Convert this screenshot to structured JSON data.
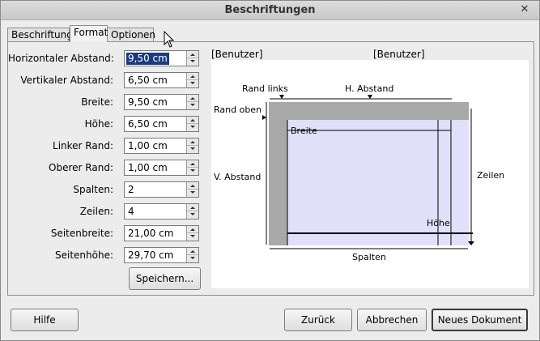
{
  "window": {
    "title": "Beschriftungen"
  },
  "tabs": [
    {
      "label": "Beschriftung",
      "active": false
    },
    {
      "label": "Format",
      "active": true
    },
    {
      "label": "Optionen",
      "active": false
    }
  ],
  "fields": [
    {
      "label": "Horizontaler Abstand:",
      "value": "9,50 cm",
      "selected": true
    },
    {
      "label": "Vertikaler Abstand:",
      "value": "6,50 cm"
    },
    {
      "label": "Breite:",
      "value": "9,50 cm"
    },
    {
      "label": "Höhe:",
      "value": "6,50 cm"
    },
    {
      "label": "Linker Rand:",
      "value": "1,00 cm"
    },
    {
      "label": "Oberer Rand:",
      "value": "1,00 cm"
    },
    {
      "label": "Spalten:",
      "value": "2"
    },
    {
      "label": "Zeilen:",
      "value": "4"
    },
    {
      "label": "Seitenbreite:",
      "value": "21,00 cm"
    },
    {
      "label": "Seitenhöhe:",
      "value": "29,70 cm"
    }
  ],
  "save_button": "Speichern...",
  "preview": {
    "header_left": "[Benutzer]",
    "header_right": "[Benutzer]",
    "rand_links": "Rand links",
    "h_abstand": "H. Abstand",
    "rand_oben": "Rand oben",
    "breite": "Breite",
    "v_abstand": "V. Abstand",
    "zeilen": "Zeilen",
    "hoehe": "Höhe",
    "spalten": "Spalten"
  },
  "footer": {
    "help": "Hilfe",
    "back": "Zurück",
    "cancel": "Abbrechen",
    "new_document": "Neues Dokument"
  },
  "colors": {
    "label_fill": "#e0e0fa",
    "margin_gray": "#a8a8a8",
    "selection": "#1c3b7c"
  }
}
